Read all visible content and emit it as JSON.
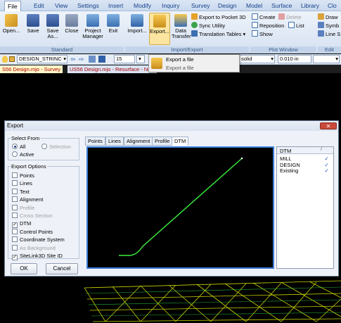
{
  "menubar": {
    "tabs": [
      "File",
      "Edit",
      "View",
      "Settings",
      "Insert",
      "Modify",
      "Inquiry",
      "Survey",
      "Design",
      "Model",
      "Surface",
      "Library",
      "Clo"
    ]
  },
  "ribbon": {
    "buttons": {
      "open": "Open...",
      "save": "Save",
      "save_as": "Save As...",
      "close": "Close",
      "project_manager": "Project Manager",
      "exit": "Exit",
      "import": "Import...",
      "export": "Export...",
      "data_transfer": "Data Transfer"
    },
    "small_items": {
      "export_pocket3d": "Export to Pocket 3D",
      "sync_utility": "Sync Utility",
      "translation_tables": "Translation Tables",
      "create": "Create",
      "delete": "Delete",
      "reposition": "Reposition",
      "list": "List",
      "show": "Show",
      "draw": "Draw",
      "symb": "Symb",
      "line_s": "Line S"
    },
    "group_labels": {
      "standard": "Standard",
      "import_export": "Import/Export",
      "plot_window": "Plot Window",
      "edit": "Edit"
    }
  },
  "toolbar": {
    "layer": "DESIGN_STRINC",
    "number": "15",
    "linetype": "solid",
    "lineweight": "0.010 in"
  },
  "export_dropdown": {
    "item": "Export a file",
    "tooltip": "Export a file"
  },
  "doc_tabs": [
    "S56 Design.mjo - Survey",
    "US56 Design.mjo - Resurface - New"
  ],
  "dialog": {
    "title": "Export",
    "select_from": {
      "legend": "Select From",
      "all": "All",
      "selection": "Selection",
      "active": "Active"
    },
    "export_options": {
      "legend": "Export Options",
      "items": [
        {
          "label": "Points",
          "checked": false,
          "enabled": true
        },
        {
          "label": "Lines",
          "checked": false,
          "enabled": true
        },
        {
          "label": "Text",
          "checked": false,
          "enabled": true
        },
        {
          "label": "Alignment",
          "checked": false,
          "enabled": true
        },
        {
          "label": "Profile",
          "checked": false,
          "enabled": false
        },
        {
          "label": "Cross Section",
          "checked": false,
          "enabled": false
        },
        {
          "label": "DTM",
          "checked": true,
          "enabled": true
        },
        {
          "label": "Control Points",
          "checked": false,
          "enabled": true
        },
        {
          "label": "Coordinate System",
          "checked": false,
          "enabled": true
        },
        {
          "label": "As Background",
          "checked": false,
          "enabled": false
        },
        {
          "label": "SiteLink3D Site ID",
          "checked": true,
          "enabled": true
        }
      ]
    },
    "ok": "OK",
    "cancel": "Cancel",
    "view_tabs": [
      "Points",
      "Lines",
      "Alignment",
      "Profile",
      "DTM"
    ],
    "dtm_list": {
      "header": "DTM",
      "rows": [
        {
          "name": "MILL",
          "checked": true
        },
        {
          "name": "DESIGN",
          "checked": true
        },
        {
          "name": "Existing",
          "checked": true
        }
      ]
    }
  }
}
